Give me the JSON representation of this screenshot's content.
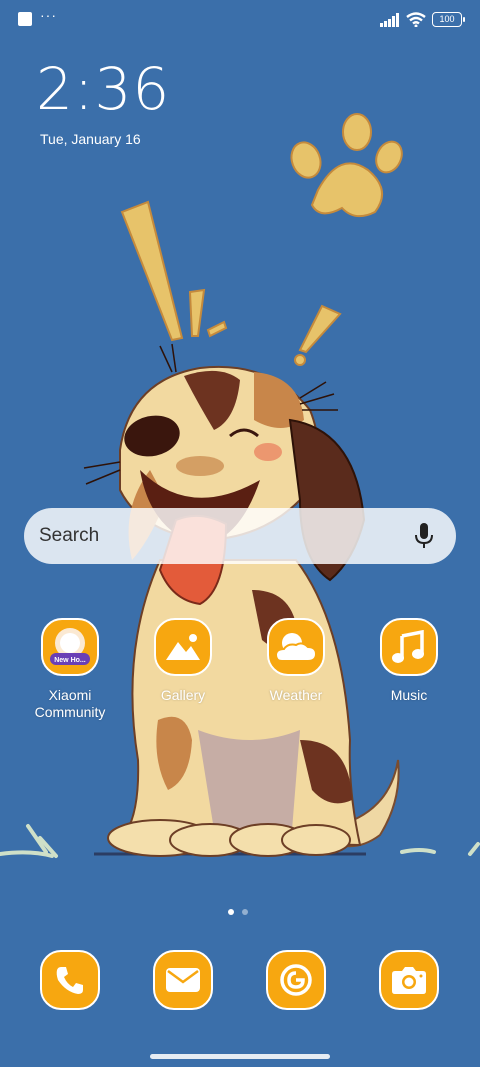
{
  "status_bar": {
    "overflow_dots": "···",
    "battery_level": "100",
    "notification_icon": "square-notification-icon",
    "signal_icon": "cell-signal-icon",
    "wifi_icon": "wifi-icon"
  },
  "lockscreen": {
    "time": "2:36",
    "date": "Tue, January 16"
  },
  "search": {
    "placeholder": "Search",
    "mic_icon": "microphone-icon"
  },
  "apps": [
    {
      "label": "Xiaomi\nCommunity",
      "icon": "xiaomi-community-icon",
      "badge_text": "New Ho..."
    },
    {
      "label": "Gallery",
      "icon": "gallery-icon"
    },
    {
      "label": "Weather",
      "icon": "weather-icon"
    },
    {
      "label": "Music",
      "icon": "music-icon"
    }
  ],
  "page_indicator": {
    "pages": 2,
    "current": 1
  },
  "dock": [
    {
      "name": "Phone",
      "icon": "phone-icon"
    },
    {
      "name": "Messages",
      "icon": "mail-icon"
    },
    {
      "name": "Browser",
      "icon": "browser-icon"
    },
    {
      "name": "Camera",
      "icon": "camera-icon"
    }
  ],
  "colors": {
    "background": "#3b6faa",
    "icon_orange": "#f7a710",
    "wallpaper_dog": "#f2d9a0",
    "wallpaper_brown": "#5a2b1c"
  }
}
